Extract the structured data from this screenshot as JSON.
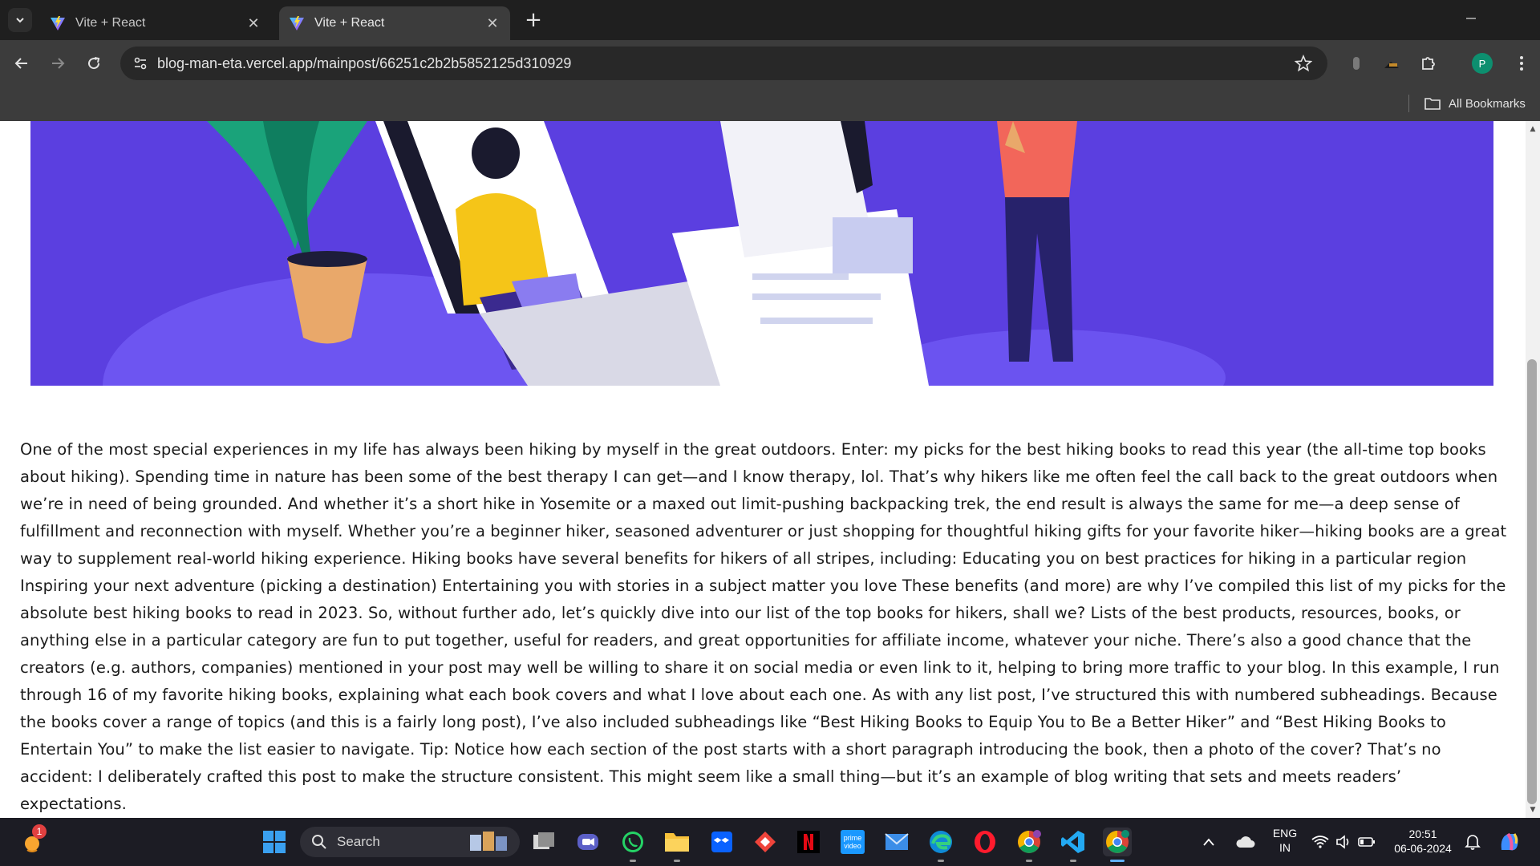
{
  "browser": {
    "tabs": [
      {
        "title": "Vite + React",
        "active": false
      },
      {
        "title": "Vite + React",
        "active": true
      }
    ],
    "url": "blog-man-eta.vercel.app/mainpost/66251c2b2b5852125d310929",
    "profile_initial": "P",
    "bookmarks_label": "All Bookmarks"
  },
  "page": {
    "article_text": "One of the most special experiences in my life has always been hiking by myself in the great outdoors. Enter: my picks for the best hiking books to read this year (the all-time top books about hiking). Spending time in nature has been some of the best therapy I can get—and I know therapy, lol. That’s why hikers like me often feel the call back to the great outdoors when we’re in need of being grounded. And whether it’s a short hike in Yosemite or a maxed out limit-pushing backpacking trek, the end result is always the same for me—a deep sense of fulfillment and reconnection with myself. Whether you’re a beginner hiker, seasoned adventurer or just shopping for thoughtful hiking gifts for your favorite hiker—hiking books are a great way to supplement real-world hiking experience. Hiking books have several benefits for hikers of all stripes, including: Educating you on best practices for hiking in a particular region Inspiring your next adventure (picking a destination) Entertaining you with stories in a subject matter you love These benefits (and more) are why I’ve compiled this list of my picks for the absolute best hiking books to read in 2023. So, without further ado, let’s quickly dive into our list of the top books for hikers, shall we? Lists of the best products, resources, books, or anything else in a particular category are fun to put together, useful for readers, and great opportunities for affiliate income, whatever your niche. There’s also a good chance that the creators (e.g. authors, companies) mentioned in your post may well be willing to share it on social media or even link to it, helping to bring more traffic to your blog. In this example, I run through 16 of my favorite hiking books, explaining what each book covers and what I love about each one. As with any list post, I’ve structured this with numbered subheadings. Because the books cover a range of topics (and this is a fairly long post), I’ve also included subheadings like “Best Hiking Books to Equip You to Be a Better Hiker” and “Best Hiking Books to Entertain You” to make the list easier to navigate. Tip: Notice how each section of the post starts with a short paragraph introducing the book, then a photo of the cover? That’s no accident: I deliberately crafted this post to make the structure consistent. This might seem like a small thing—but it’s an example of blog writing that sets and meets readers’ expectations.",
    "hero_colors": {
      "background": "#5b3fe0",
      "accent": "#7b68ff"
    }
  },
  "taskbar": {
    "search_placeholder": "Search",
    "notification_count": "1",
    "language_top": "ENG",
    "language_bottom": "IN",
    "time": "20:51",
    "date": "06-06-2024",
    "apps": [
      "windows-start",
      "file-explorer",
      "teams",
      "whatsapp",
      "folder",
      "dropbox",
      "anydesk",
      "netflix",
      "prime-video",
      "mail",
      "edge",
      "opera",
      "chrome-profile",
      "vscode",
      "chrome"
    ]
  }
}
